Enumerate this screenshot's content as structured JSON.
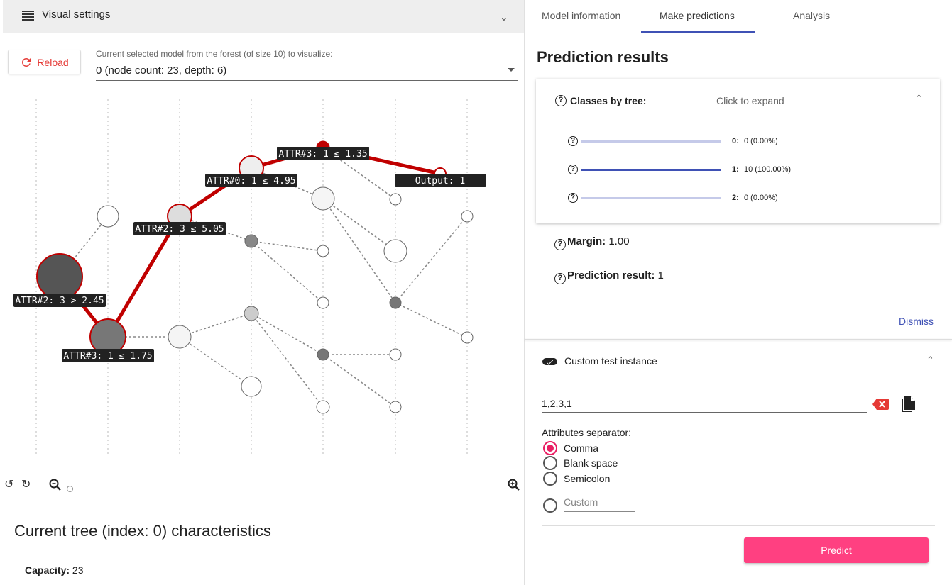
{
  "visual_settings": {
    "title": "Visual settings"
  },
  "reload_label": "Reload",
  "model_select": {
    "label": "Current selected model from the forest (of size 10) to visualize:",
    "value": "0 (node count: 23, depth: 6)"
  },
  "tree_labels": {
    "n1": "ATTR#2: 3 > 2.45",
    "n2": "ATTR#3: 1 ≤ 1.75",
    "n3": "ATTR#2: 3 ≤ 5.05",
    "n4": "ATTR#0: 1 ≤ 4.95",
    "n5": "ATTR#3: 1 ≤ 1.35",
    "n6": "Output: 1"
  },
  "tree_characteristics": {
    "title": "Current tree (index: 0) characteristics",
    "capacity_label": "Capacity:",
    "capacity_value": "23"
  },
  "tabs": [
    "Model information",
    "Make predictions",
    "Analysis"
  ],
  "prediction": {
    "title": "Prediction results",
    "classes_label": "Classes by tree:",
    "expand_hint": "Click to expand",
    "classes": [
      {
        "label": "0:",
        "value": "0 (0.00%)",
        "fraction": 0.0
      },
      {
        "label": "1:",
        "value": "10 (100.00%)",
        "fraction": 1.0
      },
      {
        "label": "2:",
        "value": "0 (0.00%)",
        "fraction": 0.0
      }
    ],
    "margin_label": "Margin:",
    "margin_value": "1.00",
    "result_label": "Prediction result:",
    "result_value": "1",
    "dismiss": "Dismiss"
  },
  "custom_instance": {
    "title": "Custom test instance",
    "value": "1,2,3,1",
    "separator_label": "Attributes separator:",
    "options": [
      "Comma",
      "Blank space",
      "Semicolon"
    ],
    "selected": "Comma",
    "custom_placeholder": "Custom",
    "predict_label": "Predict"
  },
  "colors": {
    "accent": "#3f51b5",
    "pink": "#ff4081",
    "path": "#c00000"
  }
}
